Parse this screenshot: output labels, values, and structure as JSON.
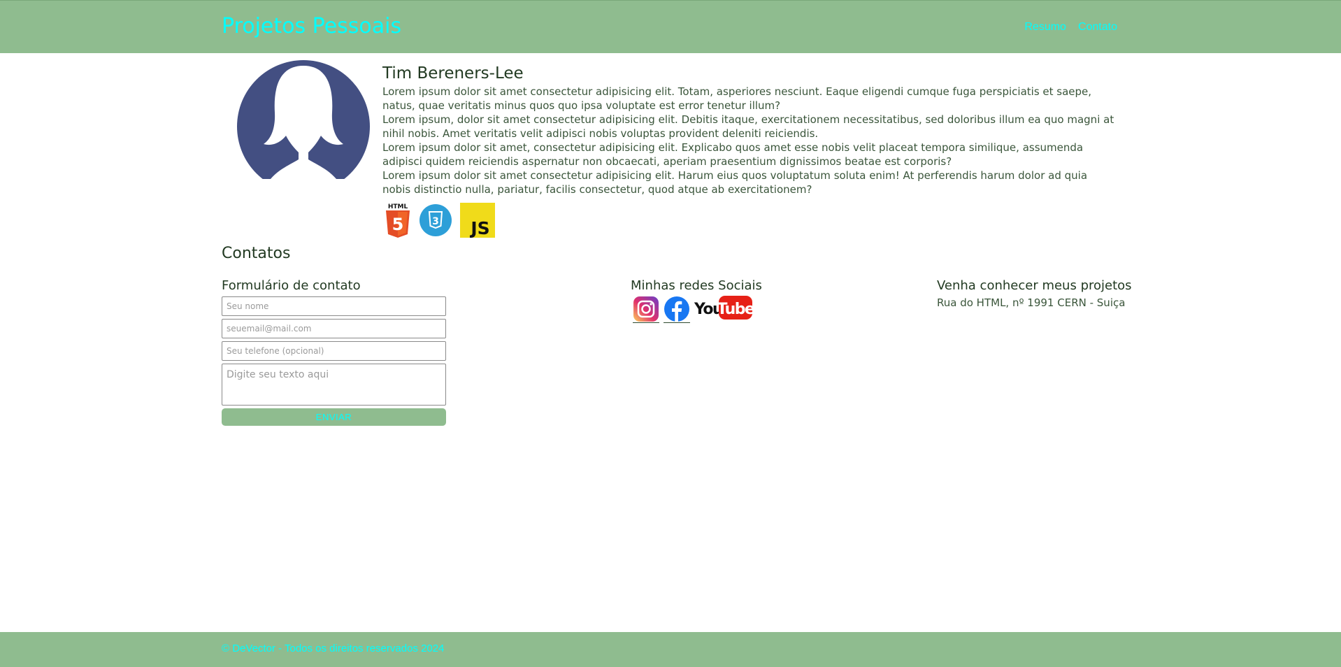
{
  "header": {
    "brand": "Projetos Pessoais",
    "nav": [
      "Resumo",
      "Contato"
    ]
  },
  "about": {
    "name": "Tim Bereners-Lee",
    "paragraphs": [
      "Lorem ipsum dolor sit amet consectetur adipisicing elit. Totam, asperiores nesciunt. Eaque eligendi cumque fuga perspiciatis et saepe, natus, quae veritatis minus quos quo ipsa voluptate est error tenetur illum?",
      "Lorem ipsum, dolor sit amet consectetur adipisicing elit. Debitis itaque, exercitationem necessitatibus, sed doloribus illum ea quo magni at nihil nobis. Amet veritatis velit adipisci nobis voluptas provident deleniti reiciendis.",
      "Lorem ipsum dolor sit amet, consectetur adipisicing elit. Explicabo quos amet esse nobis velit placeat tempora similique, assumenda adipisci quidem reiciendis aspernatur non obcaecati, aperiam praesentium dignissimos beatae est corporis?",
      "Lorem ipsum dolor sit amet consectetur adipisicing elit. Harum eius quos voluptatum soluta enim! At perferendis harum dolor ad quia nobis distinctio nulla, pariatur, facilis consectetur, quod atque ab exercitationem?"
    ],
    "skills": [
      {
        "icon": "html5-icon",
        "label": "HTML",
        "number": "5",
        "color": "#e44d26"
      },
      {
        "icon": "css3-icon",
        "number": "3",
        "color": "#2d9fd8"
      },
      {
        "icon": "javascript-icon",
        "label": "JS",
        "color": "#f0db1a"
      }
    ]
  },
  "contacts": {
    "title": "Contatos",
    "form": {
      "title": "Formulário de contato",
      "name_placeholder": "Seu nome",
      "email_placeholder": "seuemail@mail.com",
      "phone_placeholder": "Seu telefone (opcional)",
      "message_placeholder": "Digite seu texto aqui",
      "submit_label": "ENVIAR"
    },
    "social": {
      "title": "Minhas redes Sociais",
      "items": [
        {
          "icon": "instagram-icon"
        },
        {
          "icon": "facebook-icon",
          "color": "#1877f2"
        },
        {
          "icon": "youtube-icon",
          "label_left": "You",
          "label_right": "Tube",
          "color": "#e62117"
        }
      ]
    },
    "projects": {
      "title": "Venha conhecer meus projetos",
      "address": "Rua do HTML, nº 1991 CERN - Suiça"
    }
  },
  "footer": {
    "text": "© DeVector - Todos os direitos reservados 2024"
  },
  "colors": {
    "header_bg": "#8fbc8f",
    "accent_text": "#00ffff",
    "avatar": "#434f82"
  }
}
